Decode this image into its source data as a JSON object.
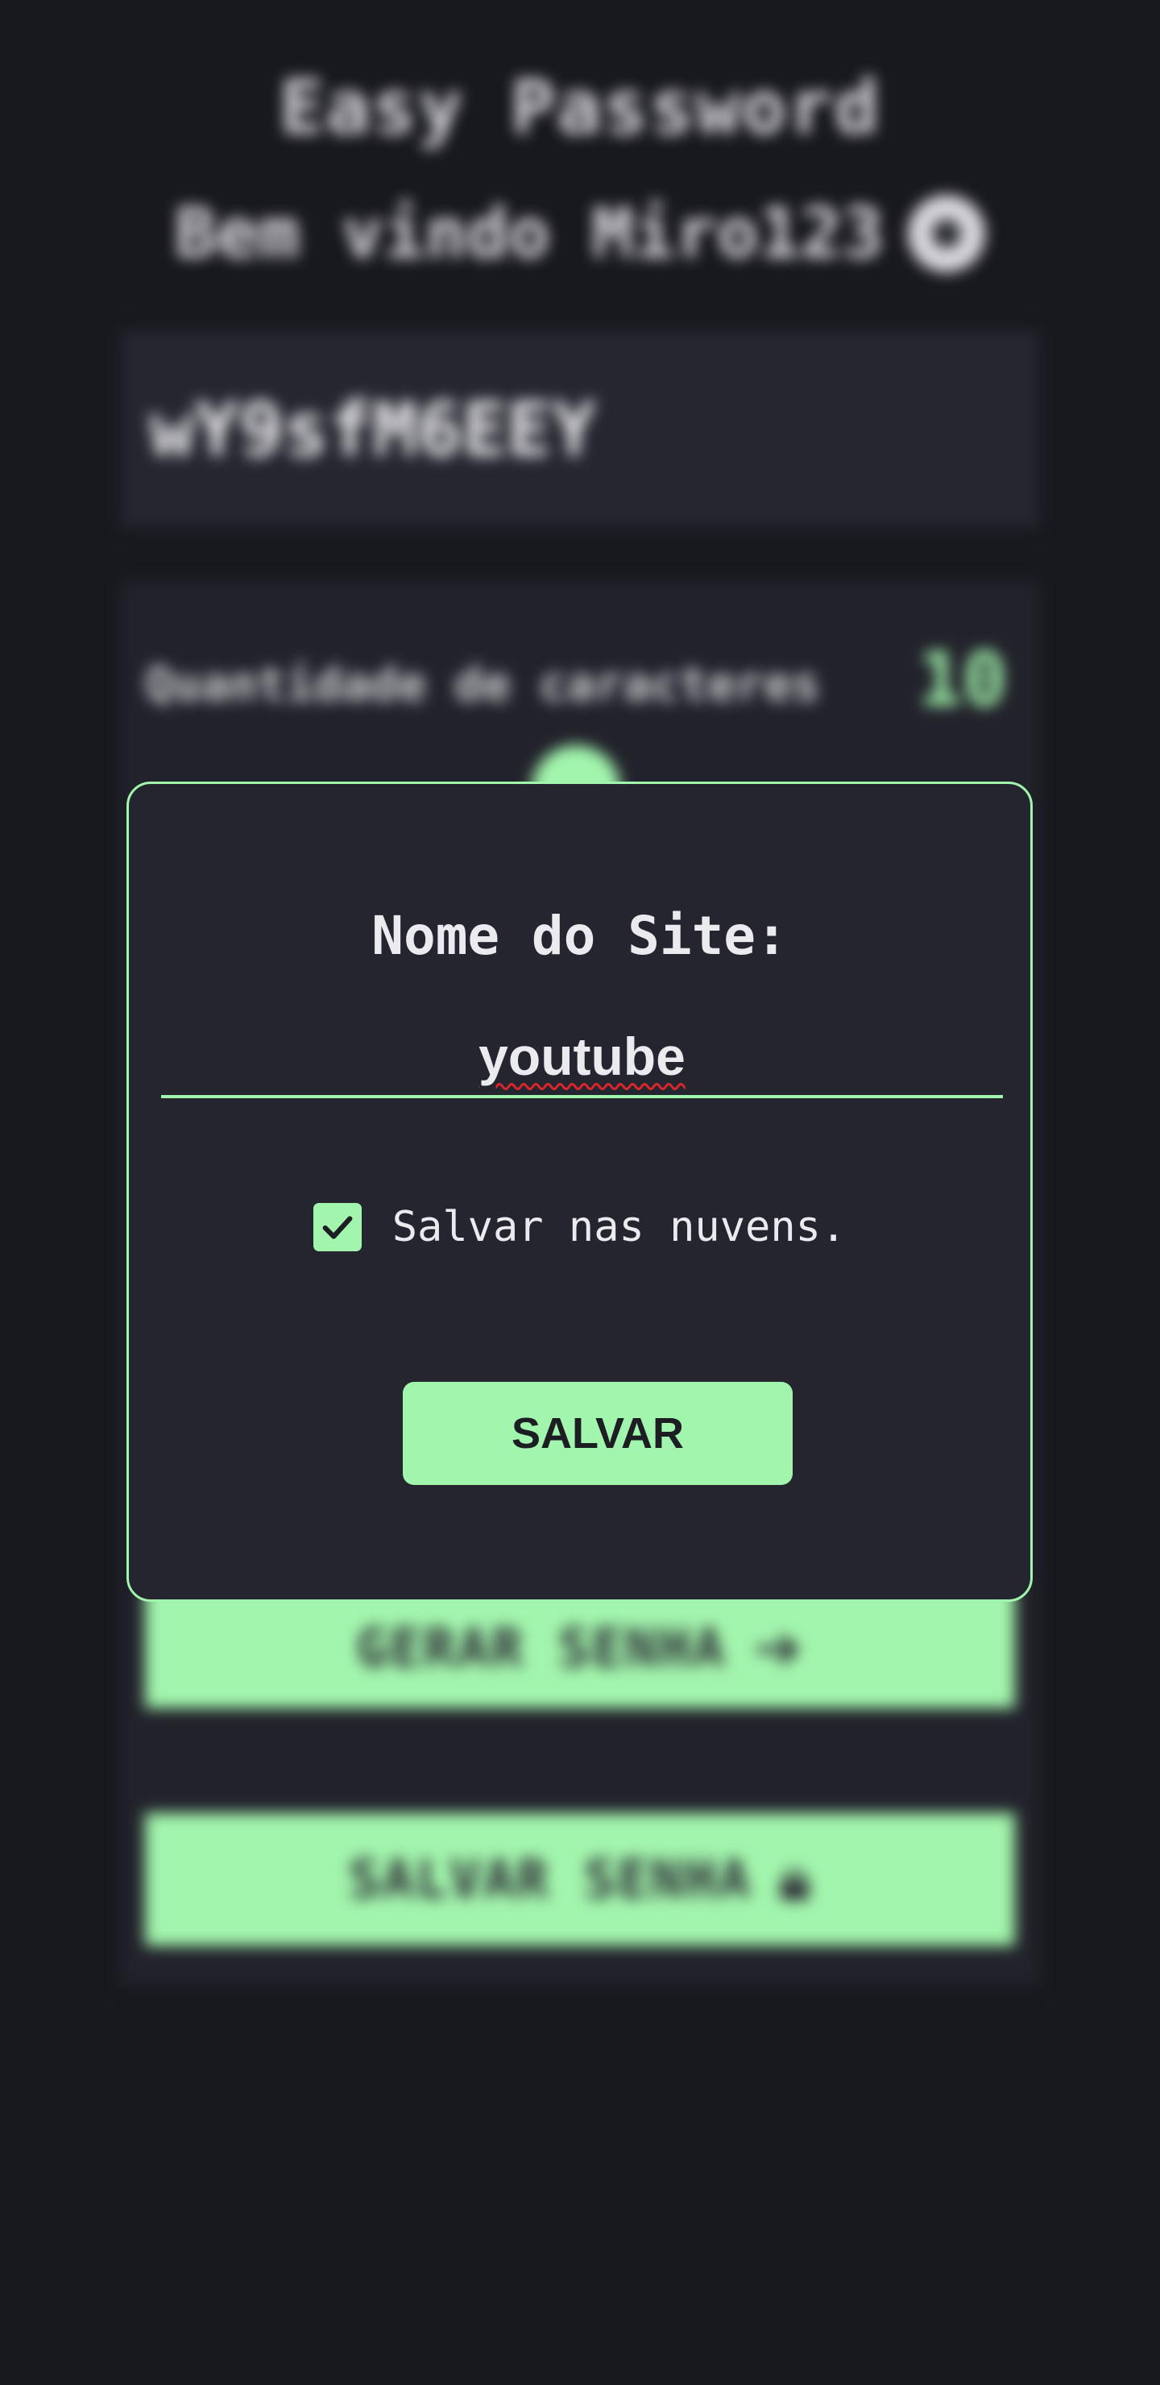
{
  "app": {
    "title": "Easy Password",
    "welcome": "Bem vindo Miro123",
    "user_icon": "user-circle-icon"
  },
  "generator": {
    "password": "wY9sfM6EEY",
    "length_label": "Quantidade de caracteres",
    "length_value": "10",
    "generate_label": "GERAR SENHA",
    "generate_icon": "arrow-right-icon",
    "save_label": "SALVAR SENHA",
    "save_icon": "lock-icon"
  },
  "modal": {
    "title": "Nome do Site:",
    "site_value": "youtube",
    "cloud_checked": true,
    "cloud_label": "Salvar nas nuvens.",
    "save_button": "SALVAR"
  },
  "colors": {
    "accent": "#a2f5ad",
    "background": "#18181f",
    "panel": "#25252f",
    "spellcheck_underline": "#d9262b"
  }
}
